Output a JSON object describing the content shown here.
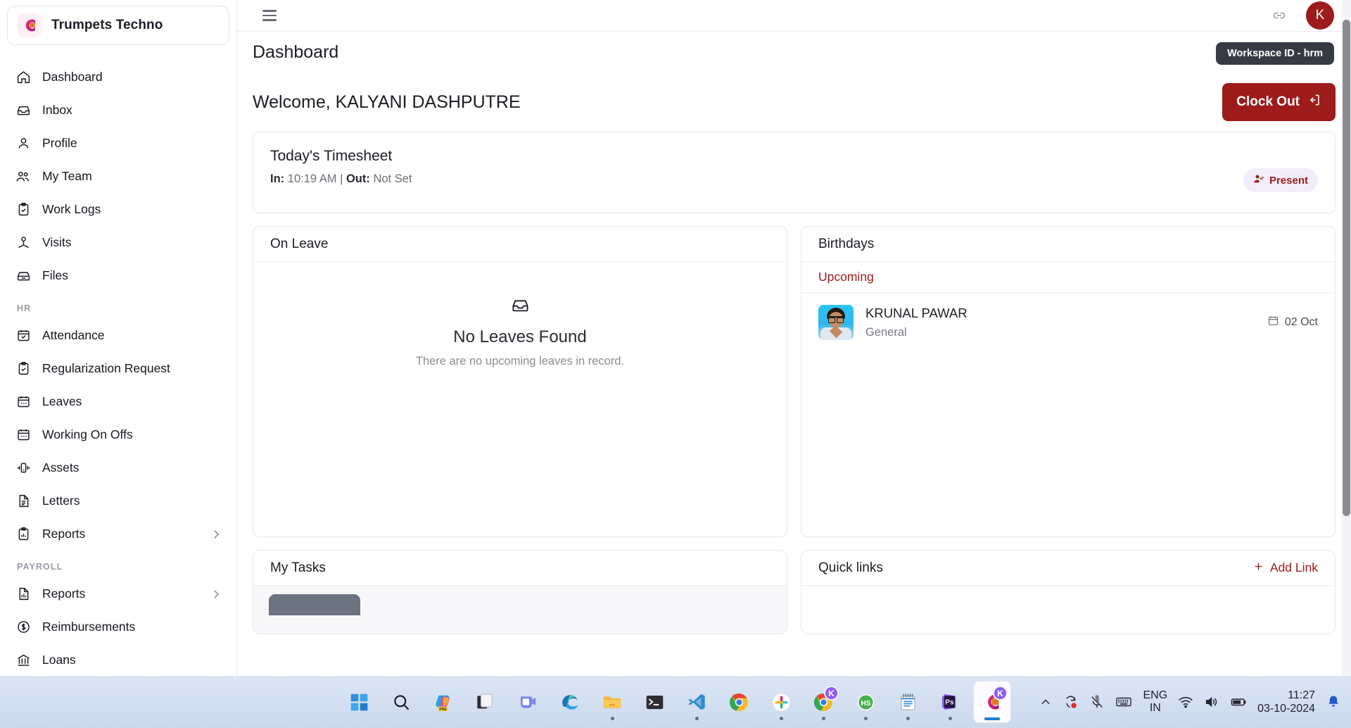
{
  "brand": {
    "name": "Trumpets Techno",
    "logo_icon": "trumpets-logo"
  },
  "sidebar": {
    "items": [
      {
        "label": "Dashboard",
        "icon": "home-icon"
      },
      {
        "label": "Inbox",
        "icon": "inbox-icon"
      },
      {
        "label": "Profile",
        "icon": "user-icon"
      },
      {
        "label": "My Team",
        "icon": "users-icon"
      },
      {
        "label": "Work Logs",
        "icon": "clipboard-check-icon"
      },
      {
        "label": "Visits",
        "icon": "user-stand-icon"
      },
      {
        "label": "Files",
        "icon": "files-icon"
      }
    ],
    "hr_section": "HR",
    "hr_items": [
      {
        "label": "Attendance",
        "icon": "calendar-check-icon"
      },
      {
        "label": "Regularization Request",
        "icon": "clipboard-check-icon"
      },
      {
        "label": "Leaves",
        "icon": "calendar-dots-icon"
      },
      {
        "label": "Working On Offs",
        "icon": "calendar-dots-icon"
      },
      {
        "label": "Assets",
        "icon": "device-icon"
      },
      {
        "label": "Letters",
        "icon": "document-icon"
      },
      {
        "label": "Reports",
        "icon": "clipboard-chart-icon",
        "has_caret": true
      }
    ],
    "payroll_section": "PAYROLL",
    "payroll_items": [
      {
        "label": "Reports",
        "icon": "chart-doc-icon",
        "has_caret": true
      },
      {
        "label": "Reimbursements",
        "icon": "dollar-circle-icon"
      },
      {
        "label": "Loans",
        "icon": "bank-icon"
      }
    ]
  },
  "topbar": {
    "menu_icon": "hamburger-icon",
    "link_icon": "link-icon",
    "avatar_initial": "K"
  },
  "page": {
    "title": "Dashboard",
    "workspace_badge": "Workspace ID - hrm",
    "welcome": "Welcome, KALYANI DASHPUTRE",
    "clock_out_label": "Clock Out"
  },
  "timesheet": {
    "title": "Today's Timesheet",
    "in_label": "In:",
    "in_value": "10:19 AM",
    "separator": "|",
    "out_label": "Out:",
    "out_value": "Not Set",
    "status": "Present"
  },
  "on_leave": {
    "title": "On Leave",
    "empty_title": "No Leaves Found",
    "empty_sub": "There are no upcoming leaves in record."
  },
  "birthdays": {
    "title": "Birthdays",
    "section": "Upcoming",
    "entries": [
      {
        "name": "KRUNAL PAWAR",
        "department": "General",
        "date": "02 Oct"
      }
    ]
  },
  "my_tasks": {
    "title": "My Tasks"
  },
  "quick_links": {
    "title": "Quick links",
    "add_label": "Add Link",
    "add_icon": "plus-icon"
  },
  "colors": {
    "accent_red": "#9e1b1b",
    "badge_dark": "#353a45",
    "pill_bg": "#f3edfb",
    "muted_text": "#8b8b98"
  },
  "taskbar": {
    "apps": [
      {
        "name": "start-button",
        "icon": "windows-icon",
        "running": false
      },
      {
        "name": "search",
        "icon": "search-icon",
        "running": false
      },
      {
        "name": "copilot-preview",
        "icon": "copilot-icon",
        "running": false
      },
      {
        "name": "task-view",
        "icon": "task-view-icon",
        "running": false
      },
      {
        "name": "teams",
        "icon": "teams-icon",
        "running": false
      },
      {
        "name": "edge",
        "icon": "edge-icon",
        "running": false
      },
      {
        "name": "file-explorer",
        "icon": "folder-icon",
        "running": true
      },
      {
        "name": "terminal",
        "icon": "terminal-icon",
        "running": false
      },
      {
        "name": "vs-code",
        "icon": "vscode-icon",
        "running": true
      },
      {
        "name": "chrome",
        "icon": "chrome-icon",
        "running": false
      },
      {
        "name": "slack",
        "icon": "slack-icon",
        "running": true
      },
      {
        "name": "chrome-profile-k",
        "icon": "chrome-icon",
        "running": true,
        "badge": "K"
      },
      {
        "name": "hubspot",
        "icon": "hubspot-icon",
        "running": true
      },
      {
        "name": "notepad",
        "icon": "notepad-icon",
        "running": true
      },
      {
        "name": "photoshop",
        "icon": "photoshop-icon",
        "running": true
      },
      {
        "name": "trumpets-app",
        "icon": "trumpets-logo",
        "active": true,
        "badge": "K"
      }
    ],
    "tray": {
      "chevron_icon": "chevron-up-icon",
      "sync_icon": "sync-icon",
      "mute_icon": "mic-muted-icon",
      "keyboard_icon": "keyboard-icon",
      "language_line1": "ENG",
      "language_line2": "IN",
      "wifi_icon": "wifi-icon",
      "volume_icon": "volume-icon",
      "battery_icon": "battery-icon",
      "time": "11:27",
      "date": "03-10-2024",
      "notification_icon": "bell-icon"
    }
  }
}
